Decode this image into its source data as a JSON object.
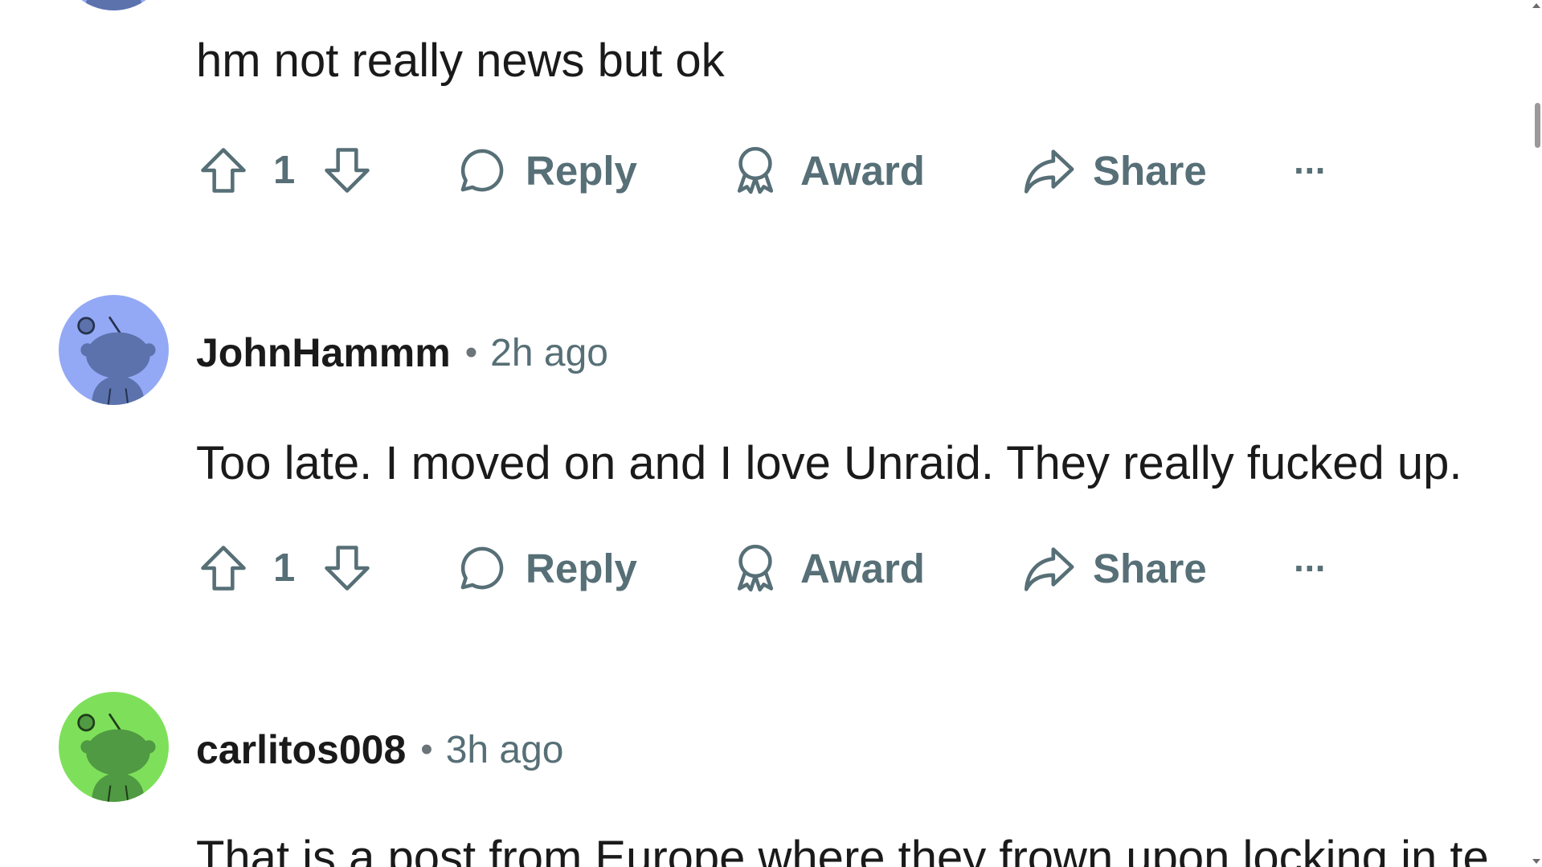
{
  "comments": [
    {
      "body": "hm not really news but ok",
      "score": "1",
      "actions": {
        "reply": "Reply",
        "award": "Award",
        "share": "Share",
        "more": "···"
      }
    },
    {
      "username": "JohnHammm",
      "separator": "•",
      "time": "2h ago",
      "avatar_color": "#94a9f5",
      "body": "Too late. I moved on and I love Unraid. They really fucked up.",
      "score": "1",
      "actions": {
        "reply": "Reply",
        "award": "Award",
        "share": "Share",
        "more": "···"
      }
    },
    {
      "username": "carlitos008",
      "separator": "•",
      "time": "3h ago",
      "avatar_color": "#7ee05a",
      "body": "That is a post from Europe where they frown upon locking in te"
    }
  ],
  "colors": {
    "text": "#1a1a1b",
    "muted": "#576f76"
  }
}
